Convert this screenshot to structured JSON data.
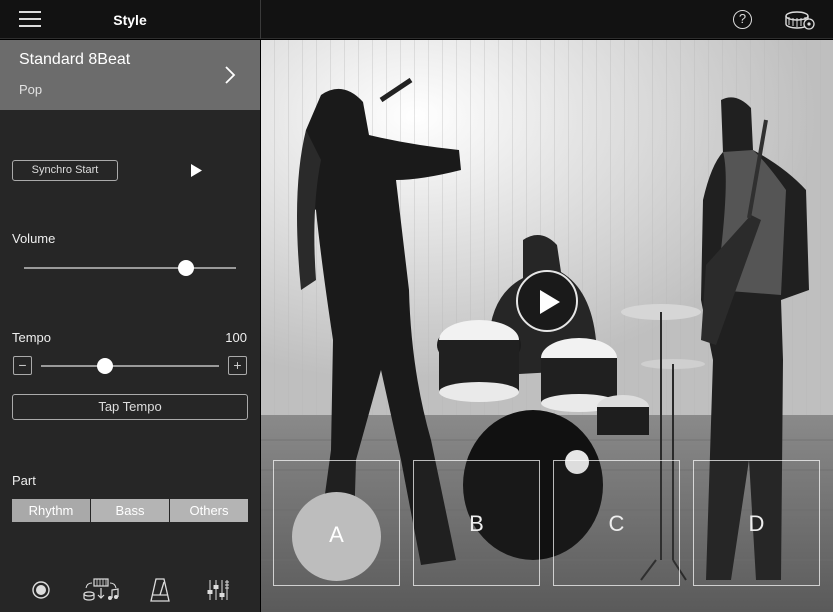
{
  "header": {
    "title": "Style",
    "menu_icon": "hamburger-menu-icon",
    "help_icon": "help-icon",
    "help_glyph": "?",
    "kit_icon": "drum-kit-settings-icon"
  },
  "style": {
    "name": "Standard 8Beat",
    "category": "Pop"
  },
  "controls": {
    "synchro_start_label": "Synchro Start",
    "volume_label": "Volume",
    "volume_level": 0.75,
    "tempo_label": "Tempo",
    "tempo_value": "100",
    "tempo_minus": "−",
    "tempo_plus": "+",
    "tap_tempo_label": "Tap Tempo",
    "part_label": "Part",
    "parts": [
      "Rhythm",
      "Bass",
      "Others"
    ]
  },
  "toolbar": {
    "icons": [
      "record-icon",
      "style-convert-icon",
      "metronome-icon",
      "mixer-icon"
    ]
  },
  "sections": [
    "A",
    "B",
    "C",
    "D"
  ],
  "colors": {
    "sidebar_bg": "#262626",
    "style_selector_bg": "#6c6c6c",
    "active_section": "#bdbdbd"
  }
}
